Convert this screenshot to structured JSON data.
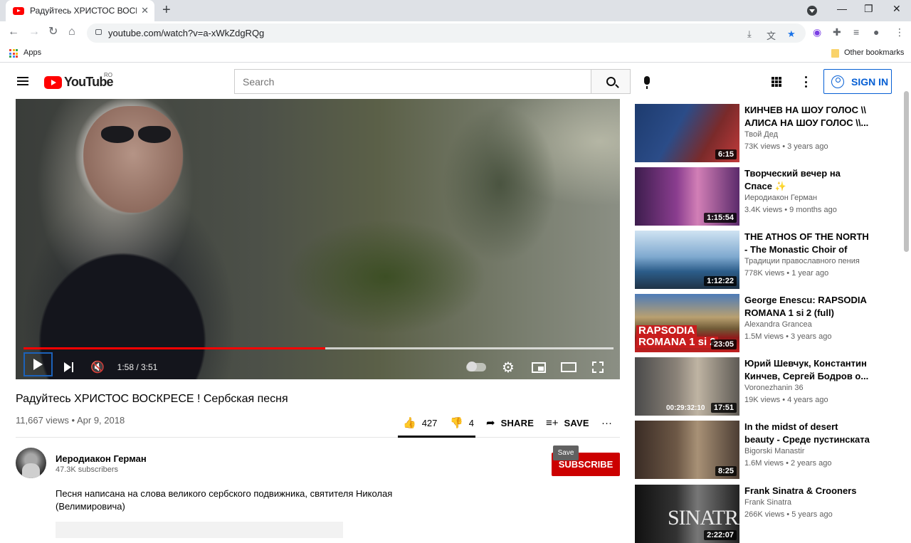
{
  "browser": {
    "tab_title": "Радуйтесь ХРИСТОС ВОСКРЕСЕ ! С",
    "url": "youtube.com/watch?v=a-xWkZdgRQg",
    "bookmarks": {
      "apps": "Apps",
      "other": "Other bookmarks"
    }
  },
  "header": {
    "logo": "YouTube",
    "region": "RO",
    "search_placeholder": "Search",
    "sign_in": "SIGN IN"
  },
  "player": {
    "time": "1:58 / 3:51",
    "progress": 0.511,
    "buffered": 1.0
  },
  "video": {
    "title": "Радуйтесь ХРИСТОС ВОСКРЕСЕ ! Сербская песня",
    "meta": "11,667 views • Apr 9, 2018",
    "likes": "427",
    "dislikes": "4",
    "share": "SHARE",
    "save": "SAVE",
    "like_ratio": 0.99
  },
  "channel": {
    "name": "Иеродиакон Герман",
    "subscribers": "47.3K subscribers",
    "subscribe": "SUBSCRIBE",
    "tooltip": "Save"
  },
  "description": "Песня написана на слова великого сербского подвижника, святителя Николая (Велимировича)",
  "sidebar": [
    {
      "title": "КИНЧЕВ НА ШОУ ГОЛОС \\\\ АЛИСА НА ШОУ ГОЛОС \\\\...",
      "channel": "Твой Дед",
      "stats": "73K views • 3 years ago",
      "duration": "6:15"
    },
    {
      "title": "Творческий вечер на Спасе ✨",
      "channel": "Иеродиакон Герман",
      "stats": "3.4K views • 9 months ago",
      "duration": "1:15:54"
    },
    {
      "title": "THE ATHOS OF THE NORTH - The Monastic Choir of the...",
      "channel": "Традиции православного пения",
      "stats": "778K views • 1 year ago",
      "duration": "1:12:22"
    },
    {
      "title": "George Enescu: RAPSODIA ROMANA 1 si 2 (full)",
      "channel": "Alexandra Grancea",
      "stats": "1.5M views • 3 years ago",
      "duration": "23:05",
      "overlay_1": "RAPSODIA",
      "overlay_2": "ROMANA 1 si 2"
    },
    {
      "title": "Юрий Шевчук, Константин Кинчев, Сергей Бодров о...",
      "channel": "Voronezhanin 36",
      "stats": "19K views • 4 years ago",
      "duration": "17:51",
      "overlay": "00:29:32:10"
    },
    {
      "title": "In the midst of desert beauty - Среде пустинската убост",
      "channel": "Bigorski Manastir",
      "stats": "1.6M views • 2 years ago",
      "duration": "8:25"
    },
    {
      "title": "Frank Sinatra & Crooners",
      "channel": "Frank Sinatra",
      "stats": "266K views • 5 years ago",
      "duration": "2:22:07",
      "overlay": "SINATRA"
    }
  ]
}
